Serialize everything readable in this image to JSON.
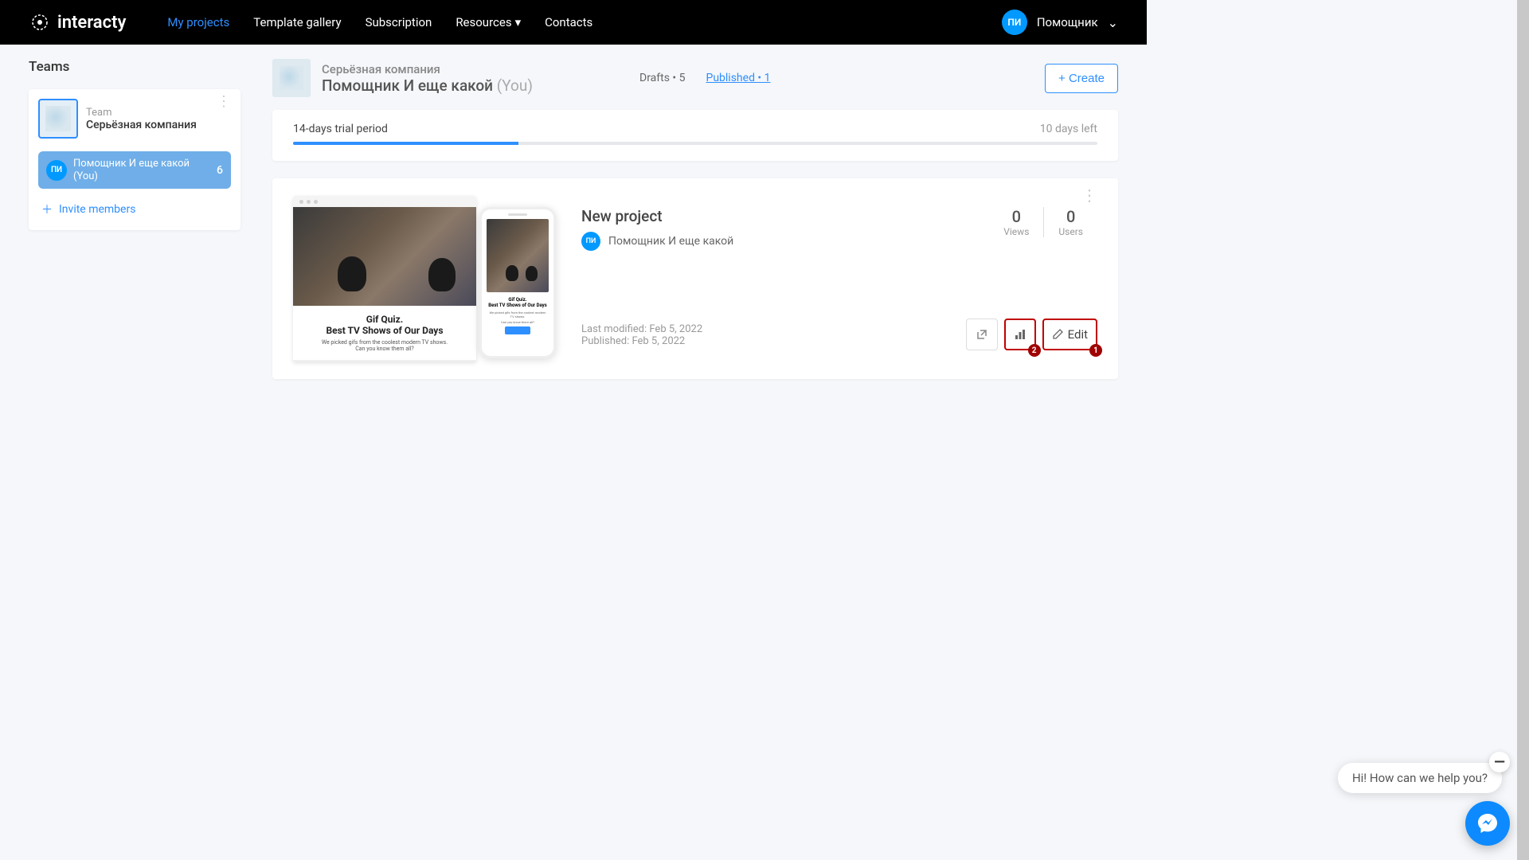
{
  "brand": {
    "name": "interacty"
  },
  "nav": {
    "my_projects": "My projects",
    "template_gallery": "Template gallery",
    "subscription": "Subscription",
    "resources": "Resources",
    "contacts": "Contacts"
  },
  "user": {
    "initials": "ПИ",
    "name": "Помощник"
  },
  "sidebar": {
    "title": "Teams",
    "team_label": "Team",
    "team_name": "Серьёзная компания",
    "member_initials": "ПИ",
    "member_name": "Помощник И еще какой (You)",
    "member_count": "6",
    "invite": "Invite members"
  },
  "head": {
    "company": "Серьёзная компания",
    "owner": "Помощник И еще какой",
    "you": "(You)",
    "drafts": "Drafts • 5",
    "published": "Published  • 1",
    "create": "+ Create"
  },
  "trial": {
    "title": "14-days trial period",
    "left": "10 days left"
  },
  "project": {
    "preview": {
      "title1": "Gif Quiz.",
      "title2": "Best TV Shows of Our Days",
      "sub": "We picked gifs from the coolest modern TV shows.",
      "sub2": "Can you know them all?",
      "btn": "Start quiz"
    },
    "title": "New project",
    "author_initials": "ПИ",
    "author_name": "Помощник И еще какой",
    "modified": "Last modified: Feb 5, 2022",
    "published": "Published: Feb 5, 2022",
    "views_num": "0",
    "views_lbl": "Views",
    "users_num": "0",
    "users_lbl": "Users",
    "edit": "Edit",
    "badge1": "1",
    "badge2": "2"
  },
  "chat": {
    "msg": "Hi! How can we help you?",
    "close": "—"
  }
}
